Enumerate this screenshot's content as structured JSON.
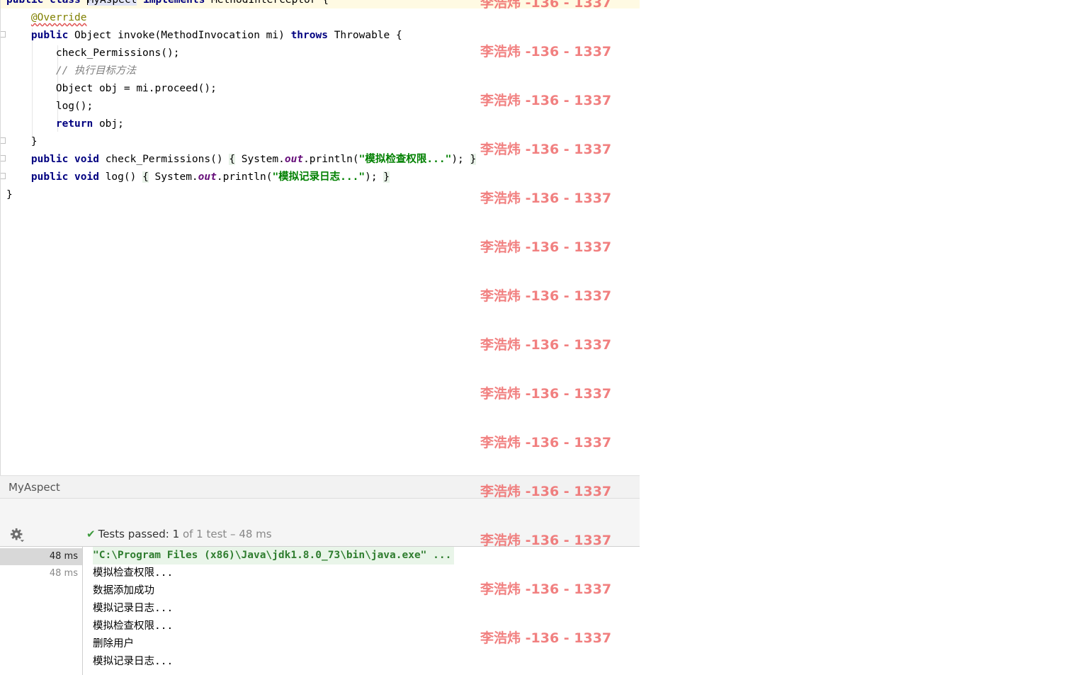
{
  "editor": {
    "lines": [
      [
        {
          "t": "public class ",
          "c": "kw"
        },
        {
          "t": "",
          "c": "caret"
        },
        {
          "t": "MyAspect",
          "c": "sel"
        },
        {
          "t": " implements ",
          "c": "kw"
        },
        {
          "t": "MethodInterceptor {",
          "c": ""
        }
      ],
      [
        {
          "t": "    ",
          "c": ""
        },
        {
          "t": "@Override",
          "c": "ann"
        }
      ],
      [
        {
          "t": "    ",
          "c": ""
        },
        {
          "t": "public ",
          "c": "kw"
        },
        {
          "t": "Object invoke(MethodInvocation mi) ",
          "c": ""
        },
        {
          "t": "throws ",
          "c": "kw"
        },
        {
          "t": "Throwable {",
          "c": ""
        }
      ],
      [
        {
          "t": "        check_Permissions();",
          "c": ""
        }
      ],
      [
        {
          "t": "        ",
          "c": ""
        },
        {
          "t": "// 执行目标方法",
          "c": "cmt"
        }
      ],
      [
        {
          "t": "        Object obj = mi.proceed();",
          "c": ""
        }
      ],
      [
        {
          "t": "        log();",
          "c": ""
        }
      ],
      [
        {
          "t": "        ",
          "c": ""
        },
        {
          "t": "return ",
          "c": "kw"
        },
        {
          "t": "obj;",
          "c": ""
        }
      ],
      [
        {
          "t": "    }",
          "c": ""
        }
      ],
      [
        {
          "t": "    ",
          "c": ""
        },
        {
          "t": "public void ",
          "c": "kw"
        },
        {
          "t": "check_Permissions() ",
          "c": ""
        },
        {
          "t": "{",
          "c": "brace"
        },
        {
          "t": " System.",
          "c": ""
        },
        {
          "t": "out",
          "c": "fld"
        },
        {
          "t": ".println(",
          "c": ""
        },
        {
          "t": "\"模拟检查权限...\"",
          "c": "str"
        },
        {
          "t": "); ",
          "c": ""
        },
        {
          "t": "}",
          "c": "brace"
        }
      ],
      [
        {
          "t": "    ",
          "c": ""
        },
        {
          "t": "public void ",
          "c": "kw"
        },
        {
          "t": "log() ",
          "c": ""
        },
        {
          "t": "{",
          "c": "brace"
        },
        {
          "t": " System.",
          "c": ""
        },
        {
          "t": "out",
          "c": "fld"
        },
        {
          "t": ".println(",
          "c": ""
        },
        {
          "t": "\"模拟记录日志...\"",
          "c": "str"
        },
        {
          "t": "); ",
          "c": ""
        },
        {
          "t": "}",
          "c": "brace"
        }
      ],
      [
        {
          "t": "}",
          "c": ""
        }
      ]
    ]
  },
  "run_panel": {
    "tab_title": "MyAspect",
    "status": {
      "label": "Tests passed: ",
      "passed": "1",
      "rest": " of 1 test – 48 ms"
    },
    "tree": [
      {
        "duration": "48 ms",
        "selected": true
      },
      {
        "duration": "48 ms",
        "selected": false
      }
    ],
    "console": [
      "\"C:\\Program Files (x86)\\Java\\jdk1.8.0_73\\bin\\java.exe\" ...",
      "模拟检查权限...",
      "数据添加成功",
      "模拟记录日志...",
      "模拟检查权限...",
      "删除用户",
      "模拟记录日志..."
    ]
  },
  "watermark": {
    "text": "李浩炜 -136 - 1337",
    "repeat": 14,
    "color": "#ef6a6a"
  },
  "icons": {
    "settings": "gear-icon",
    "passed": "check-icon"
  }
}
